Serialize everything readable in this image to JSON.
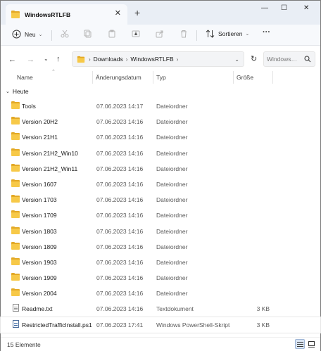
{
  "window": {
    "tab_title": "WindowsRTLFB",
    "new_tab": "+",
    "close_tab": "✕",
    "minimize": "—",
    "maximize": "☐",
    "close": "✕"
  },
  "commandbar": {
    "new_label": "Neu",
    "sort_label": "Sortieren",
    "more_label": "···"
  },
  "addressbar": {
    "crumbs": [
      "Downloads",
      "WindowsRTLFB"
    ],
    "search_placeholder": "Windows…"
  },
  "columns": {
    "name": "Name",
    "date": "Änderungsdatum",
    "type": "Typ",
    "size": "Größe"
  },
  "group": {
    "label": "Heute"
  },
  "files": [
    {
      "name": "Tools",
      "date": "07.06.2023 14:17",
      "type": "Dateiordner",
      "size": "",
      "icon": "folder-icon"
    },
    {
      "name": "Version 20H2",
      "date": "07.06.2023 14:16",
      "type": "Dateiordner",
      "size": "",
      "icon": "folder-icon"
    },
    {
      "name": "Version 21H1",
      "date": "07.06.2023 14:16",
      "type": "Dateiordner",
      "size": "",
      "icon": "folder-icon"
    },
    {
      "name": "Version 21H2_Win10",
      "date": "07.06.2023 14:16",
      "type": "Dateiordner",
      "size": "",
      "icon": "folder-icon"
    },
    {
      "name": "Version 21H2_Win11",
      "date": "07.06.2023 14:16",
      "type": "Dateiordner",
      "size": "",
      "icon": "folder-icon"
    },
    {
      "name": "Version 1607",
      "date": "07.06.2023 14:16",
      "type": "Dateiordner",
      "size": "",
      "icon": "folder-icon"
    },
    {
      "name": "Version 1703",
      "date": "07.06.2023 14:16",
      "type": "Dateiordner",
      "size": "",
      "icon": "folder-icon"
    },
    {
      "name": "Version 1709",
      "date": "07.06.2023 14:16",
      "type": "Dateiordner",
      "size": "",
      "icon": "folder-icon"
    },
    {
      "name": "Version 1803",
      "date": "07.06.2023 14:16",
      "type": "Dateiordner",
      "size": "",
      "icon": "folder-icon"
    },
    {
      "name": "Version 1809",
      "date": "07.06.2023 14:16",
      "type": "Dateiordner",
      "size": "",
      "icon": "folder-icon"
    },
    {
      "name": "Version 1903",
      "date": "07.06.2023 14:16",
      "type": "Dateiordner",
      "size": "",
      "icon": "folder-icon"
    },
    {
      "name": "Version 1909",
      "date": "07.06.2023 14:16",
      "type": "Dateiordner",
      "size": "",
      "icon": "folder-icon"
    },
    {
      "name": "Version 2004",
      "date": "07.06.2023 14:16",
      "type": "Dateiordner",
      "size": "",
      "icon": "folder-icon"
    },
    {
      "name": "Readme.txt",
      "date": "07.06.2023 14:16",
      "type": "Textdokument",
      "size": "3 KB",
      "icon": "text-file-icon"
    },
    {
      "name": "RestrictedTrafficInstall.ps1",
      "date": "07.06.2023 17:41",
      "type": "Windows PowerShell-Skript",
      "size": "3 KB",
      "icon": "powershell-file-icon"
    }
  ],
  "status": {
    "count_text": "15 Elemente"
  },
  "colors": {
    "folder_front": "#f7c948",
    "folder_back": "#e3a926",
    "titlebar": "#e9eef5",
    "accent": "#0067c0"
  }
}
